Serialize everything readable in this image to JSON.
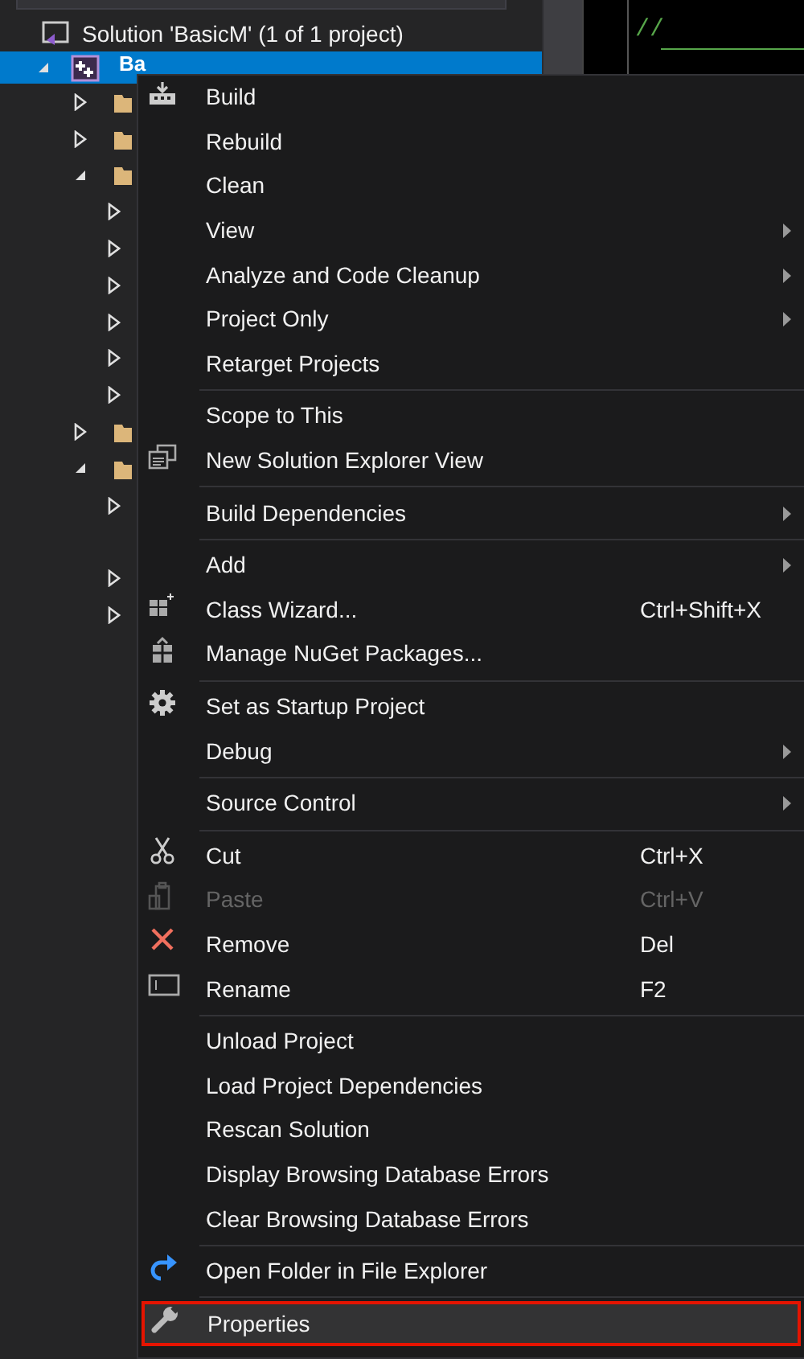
{
  "solution_explorer": {
    "solution": {
      "label": "Solution 'BasicM' (1 of 1 project)"
    },
    "project": {
      "label": "Ba",
      "selected": true,
      "expanded": true,
      "children": [
        {
          "expanded": false
        },
        {
          "expanded": false
        },
        {
          "expanded": true,
          "children": [
            {
              "expanded": false
            },
            {
              "expanded": false
            },
            {
              "expanded": false
            },
            {
              "expanded": false
            },
            {
              "expanded": false
            },
            {
              "expanded": false
            }
          ]
        },
        {
          "expanded": false
        },
        {
          "expanded": true,
          "children": [
            {
              "expanded": false
            },
            {
              "kind": "leaf"
            },
            {
              "expanded": false
            },
            {
              "expanded": false
            }
          ]
        }
      ]
    }
  },
  "editor": {
    "line_1": "//"
  },
  "context_menu": {
    "items": [
      {
        "kind": "item",
        "label": "Build"
      },
      {
        "kind": "item",
        "label": "Rebuild"
      },
      {
        "kind": "item",
        "label": "Clean"
      },
      {
        "kind": "item",
        "label": "View",
        "submenu": true
      },
      {
        "kind": "item",
        "label": "Analyze and Code Cleanup",
        "submenu": true
      },
      {
        "kind": "item",
        "label": "Project Only",
        "submenu": true
      },
      {
        "kind": "item",
        "label": "Retarget Projects"
      },
      {
        "kind": "separator"
      },
      {
        "kind": "item",
        "label": "Scope to This"
      },
      {
        "kind": "item",
        "label": "New Solution Explorer View"
      },
      {
        "kind": "separator"
      },
      {
        "kind": "item",
        "label": "Build Dependencies",
        "submenu": true
      },
      {
        "kind": "separator"
      },
      {
        "kind": "item",
        "label": "Add",
        "submenu": true
      },
      {
        "kind": "item",
        "label": "Class Wizard...",
        "shortcut": "Ctrl+Shift+X"
      },
      {
        "kind": "item",
        "label": "Manage NuGet Packages..."
      },
      {
        "kind": "separator"
      },
      {
        "kind": "item",
        "label": "Set as Startup Project"
      },
      {
        "kind": "item",
        "label": "Debug",
        "submenu": true
      },
      {
        "kind": "separator"
      },
      {
        "kind": "item",
        "label": "Source Control",
        "submenu": true
      },
      {
        "kind": "separator"
      },
      {
        "kind": "item",
        "label": "Cut",
        "shortcut": "Ctrl+X"
      },
      {
        "kind": "item",
        "label": "Paste",
        "shortcut": "Ctrl+V",
        "disabled": true
      },
      {
        "kind": "item",
        "label": "Remove",
        "shortcut": "Del"
      },
      {
        "kind": "item",
        "label": "Rename",
        "shortcut": "F2"
      },
      {
        "kind": "separator"
      },
      {
        "kind": "item",
        "label": "Unload Project"
      },
      {
        "kind": "item",
        "label": "Load Project Dependencies"
      },
      {
        "kind": "item",
        "label": "Rescan Solution"
      },
      {
        "kind": "item",
        "label": "Display Browsing Database Errors"
      },
      {
        "kind": "item",
        "label": "Clear Browsing Database Errors"
      },
      {
        "kind": "separator"
      },
      {
        "kind": "item",
        "label": "Open Folder in File Explorer"
      },
      {
        "kind": "separator"
      },
      {
        "kind": "item",
        "label": "Properties",
        "highlighted": true
      }
    ]
  }
}
